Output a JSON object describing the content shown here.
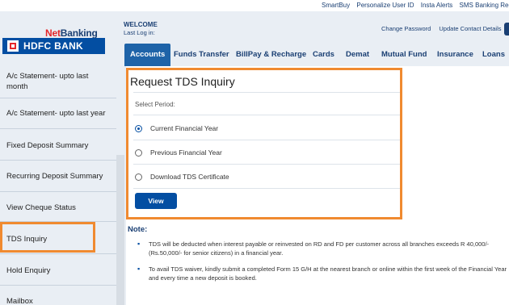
{
  "top_links": [
    "SmartBuy",
    "Personalize User ID",
    "Insta Alerts",
    "SMS Banking Registratio"
  ],
  "brand": {
    "netbanking_net": "Net",
    "netbanking_banking": "Banking",
    "bank_name": "HDFC BANK"
  },
  "header": {
    "welcome": "WELCOME",
    "last_log": "Last Log in:",
    "links": [
      "Change Password",
      "Update Contact Details"
    ]
  },
  "nav": [
    "Accounts",
    "Funds Transfer",
    "BillPay & Recharge",
    "Cards",
    "Demat",
    "Mutual Fund",
    "Insurance",
    "Loans"
  ],
  "sidebar": {
    "items": [
      "A/c Statement- upto last month",
      "A/c Statement- upto last year",
      "Fixed Deposit Summary",
      "Recurring Deposit Summary",
      "View Cheque Status",
      "TDS Inquiry",
      "Hold Enquiry",
      "Mailbox"
    ]
  },
  "panel": {
    "title": "Request TDS Inquiry",
    "select_label": "Select Period:",
    "options": [
      "Current Financial Year",
      "Previous Financial Year",
      "Download TDS Certificate"
    ],
    "selected_index": 0,
    "view_label": "View"
  },
  "note": {
    "title": "Note:",
    "items": [
      "TDS will be deducted when interest payable or reinvested on RD and FD per customer across all branches exceeds R 40,000/- (Rs.50,000/- for senior citizens) in a financial year.",
      "To avail TDS waiver, kindly submit a completed Form 15 G/H at the nearest branch or online within the first week of the Financial Year and every time a new deposit is booked."
    ]
  }
}
